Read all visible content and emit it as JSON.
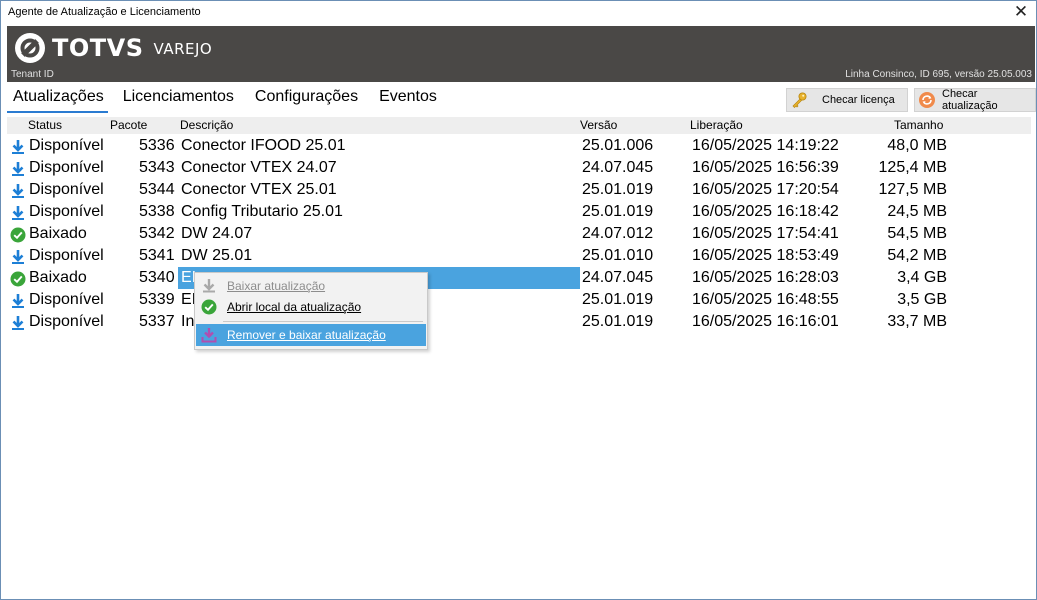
{
  "window": {
    "title": "Agente de Atualização e Licenciamento",
    "close_glyph": "✕"
  },
  "banner": {
    "brand": "TOTVS",
    "sub": "VAREJO",
    "tenant": "Tenant ID",
    "version": "Linha Consinco, ID 695, versão 25.05.003",
    "bg_color": "#4a4846"
  },
  "tabs": [
    {
      "label": "Atualizações",
      "active": true
    },
    {
      "label": "Licenciamentos",
      "active": false
    },
    {
      "label": "Configurações",
      "active": false
    },
    {
      "label": "Eventos",
      "active": false
    }
  ],
  "toolbar": {
    "check_license": {
      "label": "Checar licença",
      "icon": "key-icon"
    },
    "check_update": {
      "label": "Checar atualização",
      "icon": "refresh-icon"
    }
  },
  "table": {
    "headers": {
      "status": "Status",
      "package": "Pacote",
      "description": "Descrição",
      "version": "Versão",
      "release": "Liberação",
      "size": "Tamanho"
    },
    "rows": [
      {
        "icon": "download-icon",
        "status": "Disponível",
        "package": "5336",
        "description": "Conector IFOOD 25.01",
        "version": "25.01.006",
        "release": "16/05/2025 14:19:22",
        "size": "48,0 MB"
      },
      {
        "icon": "download-icon",
        "status": "Disponível",
        "package": "5343",
        "description": "Conector VTEX 24.07",
        "version": "24.07.045",
        "release": "16/05/2025 16:56:39",
        "size": "125,4 MB"
      },
      {
        "icon": "download-icon",
        "status": "Disponível",
        "package": "5344",
        "description": "Conector VTEX 25.01",
        "version": "25.01.019",
        "release": "16/05/2025 17:20:54",
        "size": "127,5 MB"
      },
      {
        "icon": "download-icon",
        "status": "Disponível",
        "package": "5338",
        "description": "Config Tributario 25.01",
        "version": "25.01.019",
        "release": "16/05/2025 16:18:42",
        "size": "24,5 MB"
      },
      {
        "icon": "check-circle-icon",
        "status": "Baixado",
        "package": "5342",
        "description": "DW 24.07",
        "version": "24.07.012",
        "release": "16/05/2025 17:54:41",
        "size": "54,5 MB"
      },
      {
        "icon": "download-icon",
        "status": "Disponível",
        "package": "5341",
        "description": "DW 25.01",
        "version": "25.01.010",
        "release": "16/05/2025 18:53:49",
        "size": "54,2 MB"
      },
      {
        "icon": "check-circle-icon",
        "status": "Baixado",
        "package": "5340",
        "description": "EI",
        "version": "24.07.045",
        "release": "16/05/2025 16:28:03",
        "size": "3,4 GB",
        "selected": true
      },
      {
        "icon": "download-icon",
        "status": "Disponível",
        "package": "5339",
        "description": "EI",
        "version": "25.01.019",
        "release": "16/05/2025 16:48:55",
        "size": "3,5 GB"
      },
      {
        "icon": "download-icon",
        "status": "Disponível",
        "package": "5337",
        "description": "In",
        "version": "25.01.019",
        "release": "16/05/2025 16:16:01",
        "size": "33,7 MB"
      }
    ]
  },
  "context_menu": {
    "items": [
      {
        "label": "Baixar atualização",
        "icon": "download-icon",
        "disabled": true
      },
      {
        "label": "Abrir local da atualização",
        "icon": "check-circle-icon",
        "disabled": false
      },
      {
        "label": "Remover e baixar atualização",
        "icon": "tray-download-icon",
        "disabled": false,
        "highlighted": true
      }
    ]
  },
  "colors": {
    "accent": "#2a7bd1",
    "selection": "#4aa3df",
    "download": "#1d7fd6",
    "ok": "#3aa53a"
  }
}
